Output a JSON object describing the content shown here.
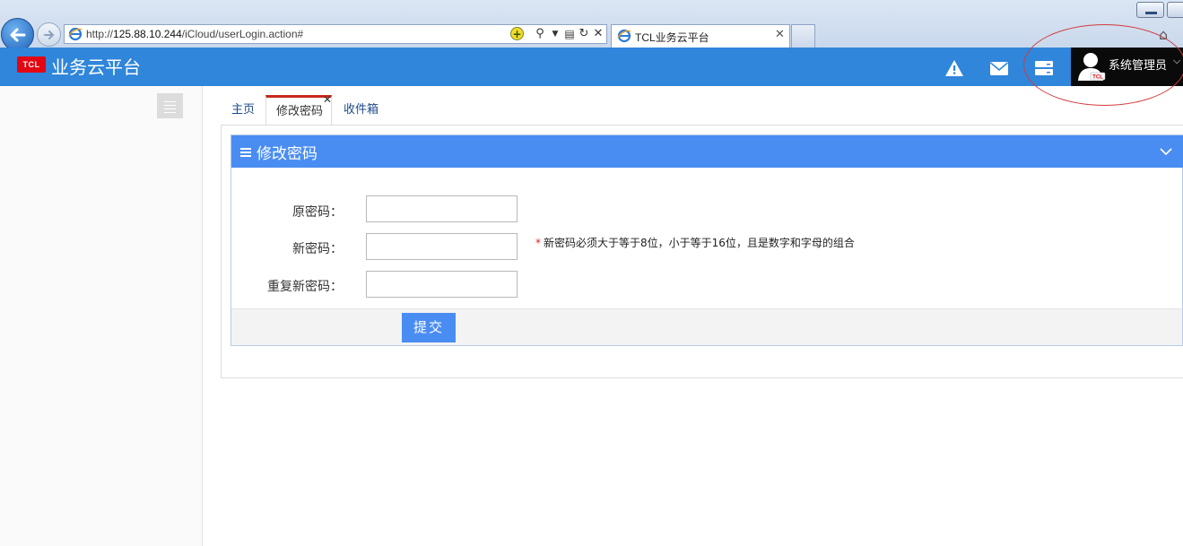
{
  "browser": {
    "url_prefix": "http://",
    "url_host": "125.88.10.244",
    "url_path": "/iCloud/userLogin.action#",
    "tab_title": "TCL业务云平台"
  },
  "header": {
    "logo_text": "TCL",
    "app_title": "业务云平台",
    "user_name": "系统管理员",
    "avatar_badge": "TCL"
  },
  "tabs": [
    {
      "label": "主页"
    },
    {
      "label": "修改密码"
    },
    {
      "label": "收件箱"
    }
  ],
  "panel": {
    "title": "修改密码"
  },
  "form": {
    "old_label": "原密码：",
    "old_value": "",
    "new_label": "新密码：",
    "new_value": "",
    "repeat_label": "重复新密码：",
    "repeat_value": "",
    "hint_star": "*",
    "hint": "新密码必须大于等于8位，小于等于16位，且是数字和字母的组合",
    "submit_label": "提交"
  },
  "colors": {
    "topbar": "#2f86da",
    "panel_header": "#4a8df2",
    "active_tab_border": "#c6291e",
    "annotation": "#d23b3b"
  }
}
